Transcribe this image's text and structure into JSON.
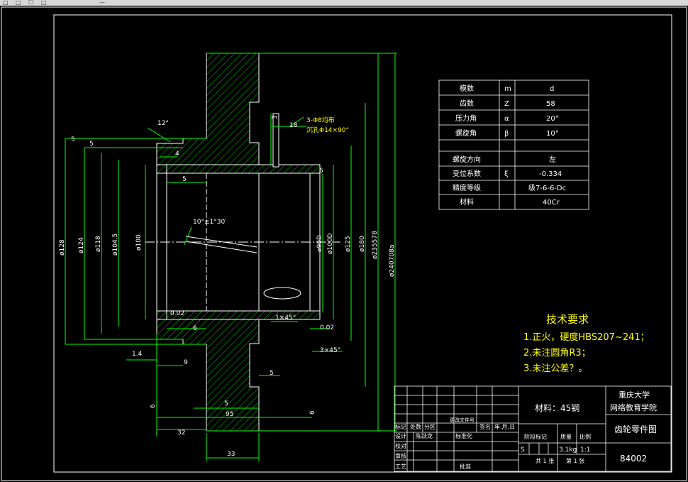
{
  "window": {
    "buttons": [
      "□",
      "□",
      "☐",
      "□",
      "—"
    ]
  },
  "params_table": {
    "rows": [
      {
        "name": "模数",
        "sym": "m",
        "val": "d"
      },
      {
        "name": "齿数",
        "sym": "Z",
        "val": "58"
      },
      {
        "name": "压力角",
        "sym": "α",
        "val": "20°"
      },
      {
        "name": "螺旋角",
        "sym": "β",
        "val": "10°"
      },
      {
        "name": "",
        "sym": "",
        "val": ""
      },
      {
        "name": "螺旋方向",
        "sym": "",
        "val": "左"
      },
      {
        "name": "变位系数",
        "sym": "ξ",
        "val": "-0.334"
      },
      {
        "name": "精度等级",
        "sym": "",
        "val": "级7-6-6-Dc"
      },
      {
        "name": "材料",
        "sym": "",
        "val": "40Cr"
      }
    ]
  },
  "tech_requirements": {
    "title": "技术要求",
    "items": [
      "1.正火，硬度HBS207~241；",
      "2.未注圆角R3；",
      "3.未注公差？。"
    ]
  },
  "dimensions": {
    "phi128": "ø128",
    "phi124": "ø124",
    "phi118": "ø118",
    "phi1045": "ø104.5",
    "phi100": "ø100",
    "phi90": "ø90D",
    "phi100d": "ø100D",
    "phi125": "ø125",
    "phi180": "ø180",
    "phi235": "ø235578",
    "phi240": "ø240708a",
    "d12deg": "12°",
    "d5a": "5",
    "d5b": "5",
    "d4": "4",
    "d5c": "5",
    "d3": "3",
    "d18": "18",
    "hole_note1": "3-Φ8均布",
    "hole_note2": "沉孔Φ14×90°",
    "angle_note": "10°±1°30′",
    "d6a": "6",
    "d6b": "6",
    "tol002a": "0.02",
    "tol002b": "0.02",
    "chamfer1": "1×45°",
    "chamfer3": "3×45°",
    "d14": "1.4",
    "d9": "9",
    "d5d": "5",
    "d5e": "5",
    "d95": "95",
    "d32": "32",
    "d33": "33",
    "d6c": "6",
    "d6d": "6"
  },
  "title_block": {
    "material": "材料：45钢",
    "school1": "重庆大学",
    "school2": "网络教育学院",
    "drawing_name": "齿轮零件图",
    "drawing_no": "84002",
    "head_labels": [
      "标记",
      "处数",
      "分区",
      "更改文件号",
      "签名",
      "年.月.日"
    ],
    "row_labels": [
      "设计",
      "校对",
      "审核",
      "工艺"
    ],
    "designer": "陈跃龙",
    "standard": "标准化",
    "approve": "批准",
    "stage": "阶段标记",
    "weight_label": "质量",
    "scale_label": "比例",
    "s_mark": "S",
    "weight": "3.1kg",
    "scale": "1:1",
    "sheets": "共  1  张",
    "sheet_no": "第  1  张"
  }
}
